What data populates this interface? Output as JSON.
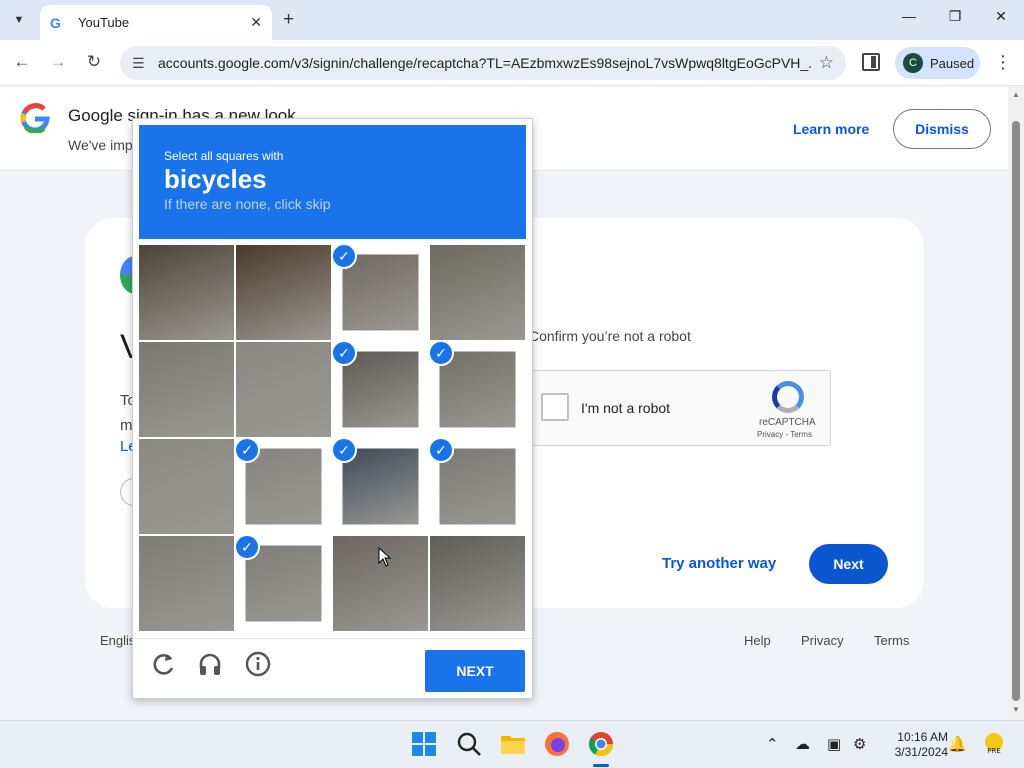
{
  "browser": {
    "tab_title": "YouTube",
    "url": "accounts.google.com/v3/signin/challenge/recaptcha?TL=AEzbmxwzEs98sejnoL7vsWpwq8ltgEoGcPVH_...",
    "profile_initial": "C",
    "profile_status": "Paused"
  },
  "banner": {
    "title": "Google sign-in has a new look",
    "subtitle": "We've imp",
    "learn_more": "Learn more",
    "dismiss": "Dismiss"
  },
  "card": {
    "heading": "V",
    "text_line1": "To",
    "text_line2": "m",
    "link": "Le",
    "confirm_text": "Confirm you’re not a robot",
    "recaptcha_label": "I'm not a robot",
    "recaptcha_brand": "reCAPTCHA",
    "recaptcha_links": "Privacy - Terms",
    "try_another": "Try another way",
    "next": "Next"
  },
  "footer": {
    "language": "Englis",
    "help": "Help",
    "privacy": "Privacy",
    "terms": "Terms"
  },
  "captcha": {
    "instruction": "Select all squares with",
    "target": "bicycles",
    "hint": "If there are none, click skip",
    "tiles": [
      {
        "selected": false,
        "color": "#4c4437"
      },
      {
        "selected": false,
        "color": "#4a3b2a"
      },
      {
        "selected": true,
        "color": "#6f6a62"
      },
      {
        "selected": false,
        "color": "#6d6b5e"
      },
      {
        "selected": false,
        "color": "#7a7873"
      },
      {
        "selected": false,
        "color": "#8a8884"
      },
      {
        "selected": true,
        "color": "#5d5a56"
      },
      {
        "selected": true,
        "color": "#736f69"
      },
      {
        "selected": false,
        "color": "#8b8984"
      },
      {
        "selected": true,
        "color": "#868480"
      },
      {
        "selected": true,
        "color": "#3f4a5a"
      },
      {
        "selected": true,
        "color": "#7b7975"
      },
      {
        "selected": false,
        "color": "#7e7c77"
      },
      {
        "selected": true,
        "color": "#7f7d79"
      },
      {
        "selected": false,
        "color": "#6b6661"
      },
      {
        "selected": false,
        "color": "#5f5d59"
      }
    ],
    "next_button": "NEXT",
    "icons": [
      "reload-icon",
      "audio-headphones-icon",
      "info-icon"
    ]
  },
  "taskbar": {
    "time": "10:16 AM",
    "date": "3/31/2024"
  },
  "colors": {
    "accent": "#1a73e8",
    "google_blue": "#0b57d0",
    "page_bg": "#f0f4f9"
  }
}
